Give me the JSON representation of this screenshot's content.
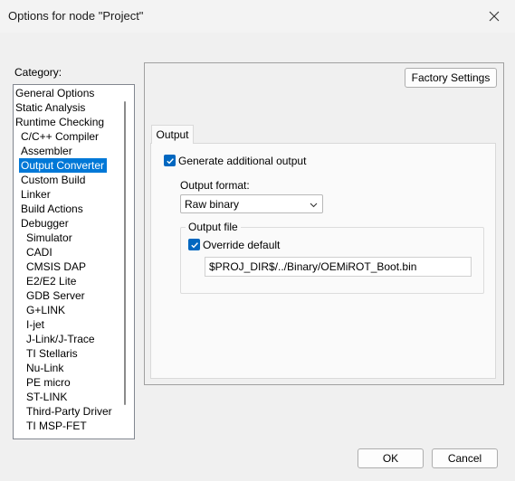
{
  "window": {
    "title": "Options for node \"Project\""
  },
  "category": {
    "label": "Category:",
    "items": [
      {
        "label": "General Options",
        "indent": 0
      },
      {
        "label": "Static Analysis",
        "indent": 0
      },
      {
        "label": "Runtime Checking",
        "indent": 0
      },
      {
        "label": "C/C++ Compiler",
        "indent": 1
      },
      {
        "label": "Assembler",
        "indent": 1
      },
      {
        "label": "Output Converter",
        "indent": 1,
        "selected": true
      },
      {
        "label": "Custom Build",
        "indent": 1
      },
      {
        "label": "Linker",
        "indent": 1
      },
      {
        "label": "Build Actions",
        "indent": 1
      },
      {
        "label": "Debugger",
        "indent": 1
      },
      {
        "label": "Simulator",
        "indent": 2
      },
      {
        "label": "CADI",
        "indent": 2
      },
      {
        "label": "CMSIS DAP",
        "indent": 2
      },
      {
        "label": "E2/E2 Lite",
        "indent": 2
      },
      {
        "label": "GDB Server",
        "indent": 2
      },
      {
        "label": "G+LINK",
        "indent": 2
      },
      {
        "label": "I-jet",
        "indent": 2
      },
      {
        "label": "J-Link/J-Trace",
        "indent": 2
      },
      {
        "label": "TI Stellaris",
        "indent": 2
      },
      {
        "label": "Nu-Link",
        "indent": 2
      },
      {
        "label": "PE micro",
        "indent": 2
      },
      {
        "label": "ST-LINK",
        "indent": 2
      },
      {
        "label": "Third-Party Driver",
        "indent": 2
      },
      {
        "label": "TI MSP-FET",
        "indent": 2
      }
    ]
  },
  "panel": {
    "factory_settings_label": "Factory Settings",
    "tab_label": "Output",
    "generate_output": {
      "label": "Generate additional output",
      "checked": true
    },
    "output_format": {
      "label": "Output format:",
      "selected": "Raw binary"
    },
    "output_file": {
      "title": "Output file",
      "override": {
        "label": "Override default",
        "checked": true
      },
      "path": "$PROJ_DIR$/../Binary/OEMiROT_Boot.bin"
    }
  },
  "buttons": {
    "ok": "OK",
    "cancel": "Cancel"
  },
  "colors": {
    "accent": "#0078d7",
    "checkbox": "#0067c0"
  },
  "icons": {
    "close": "close-icon",
    "chevron": "chevron-down-icon",
    "check": "checkmark-icon"
  }
}
